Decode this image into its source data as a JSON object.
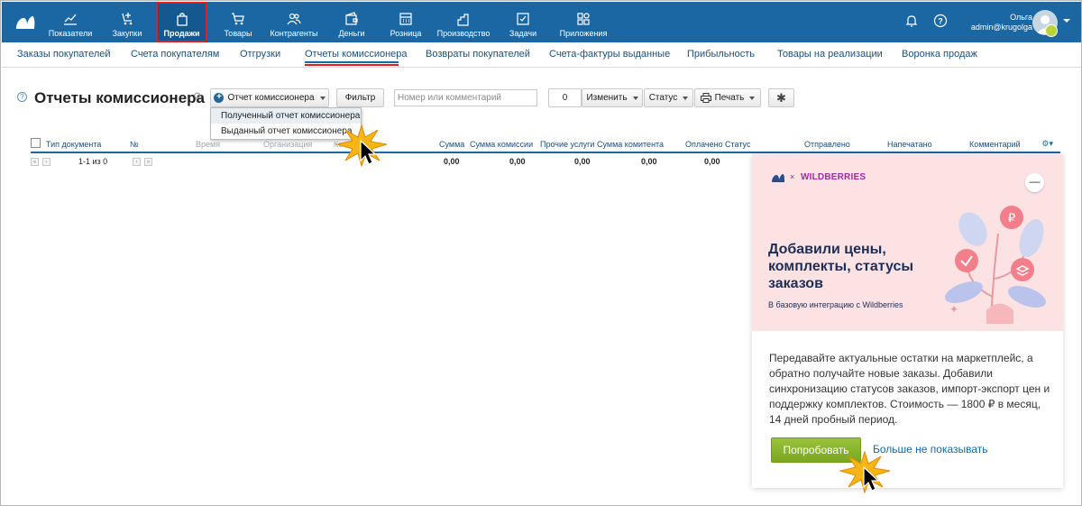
{
  "colors": {
    "nav_bg": "#1a67a3",
    "active_outline": "#e02020",
    "link": "#1a4f80",
    "promo_bg": "#fde2e4",
    "wb_brand": "#a12aa5",
    "try_button": "#8cb82d"
  },
  "topnav": {
    "items": [
      {
        "label": "Показатели",
        "icon": "chart-icon"
      },
      {
        "label": "Закупки",
        "icon": "cart-arrow-icon"
      },
      {
        "label": "Продажи",
        "icon": "bag-icon",
        "active": true
      },
      {
        "label": "Товары",
        "icon": "cart-icon"
      },
      {
        "label": "Контрагенты",
        "icon": "people-icon"
      },
      {
        "label": "Деньги",
        "icon": "wallet-icon"
      },
      {
        "label": "Розница",
        "icon": "register-icon"
      },
      {
        "label": "Производство",
        "icon": "factory-icon"
      },
      {
        "label": "Задачи",
        "icon": "checkbox-icon"
      },
      {
        "label": "Приложения",
        "icon": "apps-icon"
      }
    ],
    "user_name": "Ольга",
    "user_email": "admin@krugolga"
  },
  "subnav": {
    "items": [
      "Заказы покупателей",
      "Счета покупателям",
      "Отгрузки",
      "Отчеты комиссионера",
      "Возвраты покупателей",
      "Счета-фактуры выданные",
      "Прибыльность",
      "Товары на реализации",
      "Воронка продаж"
    ],
    "active_index": 3
  },
  "toolbar": {
    "title": "Отчеты комиссионера",
    "new_button": "Отчет комиссионера",
    "filter_button": "Фильтр",
    "search_placeholder": "Номер или комментарий",
    "count_value": "0",
    "change_button": "Изменить",
    "status_button": "Статус",
    "print_button": "Печать"
  },
  "dropdown": {
    "items": [
      "Полученный отчет комиссионера",
      "Выданный отчет комиссионера"
    ],
    "highlighted_index": 0
  },
  "table": {
    "columns": [
      "Тип документа",
      "№",
      "Время",
      "Организация",
      "Ко",
      "Сумма",
      "Сумма комиссии",
      "Прочие услуги",
      "Сумма комитента",
      "Оплачено",
      "Статус",
      "Отправлено",
      "Напечатано",
      "Комментарий"
    ],
    "pagination": "1-1 из 0",
    "totals": [
      "0,00",
      "0,00",
      "0,00",
      "0,00",
      "0,00"
    ]
  },
  "promo": {
    "brand": "WILDBERRIES",
    "x_sign": "×",
    "headline": "Добавили цены, комплекты, статусы заказов",
    "subtitle": "В базовую интеграцию с Wildberries",
    "body": "Передавайте актуальные остатки на маркетплейс, а обратно получайте новые заказы. Добавили синхронизацию статусов заказов, импорт-экспорт цен и поддержку комплектов. Стоимость — 1800 ₽ в месяц, 14 дней пробный период.",
    "try_button": "Попробовать",
    "dismiss_link": "Больше не показывать",
    "close_symbol": "—"
  }
}
